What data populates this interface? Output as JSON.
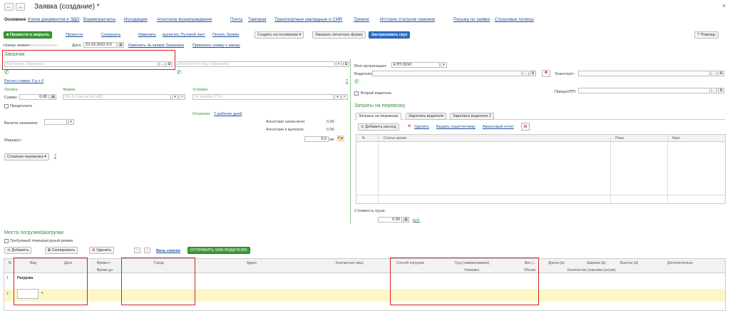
{
  "window": {
    "title": "Заявка (создание) *",
    "back": "←",
    "forward": "→",
    "close": "×"
  },
  "tabs": [
    "Основное",
    "Копии документов и ЭДО",
    "Взаиморасчеты",
    "Исходящие",
    "Агентское вознаграждение",
    "Почта",
    "Таможня",
    "Транспортные накладные и CMR",
    "Трекинг",
    "История статусов таможни",
    "Письма по заявке",
    "Страховые полисы"
  ],
  "toolbar": {
    "post_close": "Провести и закрыть",
    "post": "Провести",
    "save": "Сохранить",
    "edit": "Изменить",
    "waybill": "выписать Путевой лист",
    "print": "Печать Заявки",
    "create_based": "Создать на основании",
    "order_print_form": "Заказать печатную форму",
    "insure": "Застраховать груз",
    "help": "Помощь"
  },
  "header": {
    "number_label": "Номер заявки:",
    "number_placeholder": "<Автоматически>",
    "date_label": "Дата:",
    "date_value": "22.03.2022 0:0",
    "change_number": "Изменить № заявки Заказчика",
    "link_order": "Привязать заявку к заказу"
  },
  "customer": {
    "section": "Заказчик",
    "placeholder": "Выберите Заказчика",
    "contact_placeholder": "Контактное лицо Заказчика",
    "rate_link": "Расчет ставки: 0 р x 0"
  },
  "payment": {
    "payment_label": "Оплата",
    "form_label": "Форма",
    "condition_label": "Условие",
    "sum_label": "Сумма:",
    "sum_value": "0.00",
    "form_placeholder": "б/н (в том числе НДС",
    "condition_placeholder": "по копиям ТТН",
    "prepay": "Предоплата",
    "delay_label": "Отсрочка:",
    "delay_value": "7 рабочих дней",
    "q": "?"
  },
  "currency": {
    "label": "Валюта заказчика:"
  },
  "agent": {
    "accrued_label": "Агентские начислено:",
    "accrued_value": "0.00",
    "to_pay_label": "Агентские к выплате:",
    "to_pay_value": "0.00",
    "km_value": "0,0",
    "km_unit": "км"
  },
  "route": {
    "label": "Маршрут:",
    "complex": "Сложная перевозка",
    "q": "?"
  },
  "right": {
    "org_label": "Моя организация:",
    "org_value": "ЕТП ООО",
    "drivers_label": "Водители:",
    "transport_label": "Транспорт:",
    "trailer_label": "Прицеп/ПП:",
    "second_driver": "Второй водитель"
  },
  "costs": {
    "section": "Затраты на перевозку",
    "tabs": [
      "Затраты на перевозку",
      "Зарплата водителя",
      "Зарплата водителя 2"
    ],
    "add": "Добавить расход",
    "delete": "Удалить",
    "issue": "Выдать подотчетнику",
    "advance": "Авансовый отчет",
    "cols": [
      "N",
      "Статья затрат",
      "План",
      "Факт"
    ],
    "cargo_cost_label": "Стоимость груза:",
    "cargo_cost_value": "0.00",
    "cargo_cost_unit": "руб."
  },
  "loading": {
    "section": "Места погрузки/разгрузки",
    "temp": "Требуемый температурный режим",
    "add": "Добавить",
    "copy": "Скопировать",
    "delete": "Удалить",
    "all_list": "Весь список",
    "sms": "ОТПРАВИТЬ SMS ВОДИТЕЛЮ",
    "cols": [
      "N",
      "Вид",
      "Дата",
      "Время с",
      "Город",
      "Адрес",
      "Контактное лицо",
      "Способ погрузки",
      "Груз (наименование)",
      "Вес (...",
      "Длина (м)",
      "Ширина (м)",
      "Высота (м)",
      "Дополнительно"
    ],
    "cols2": [
      "Время до",
      "Упаковка",
      "Объем",
      "Количество упаковки (штуки)"
    ],
    "rows": [
      {
        "n": "1",
        "kind": "Погрузка"
      },
      {
        "n": "2",
        "kind": ""
      }
    ]
  },
  "colors": {
    "accent_green": "#3a9a35",
    "link": "#1a4f9c",
    "highlight": "#d62020",
    "row_yellow": "#fdf7c8"
  }
}
